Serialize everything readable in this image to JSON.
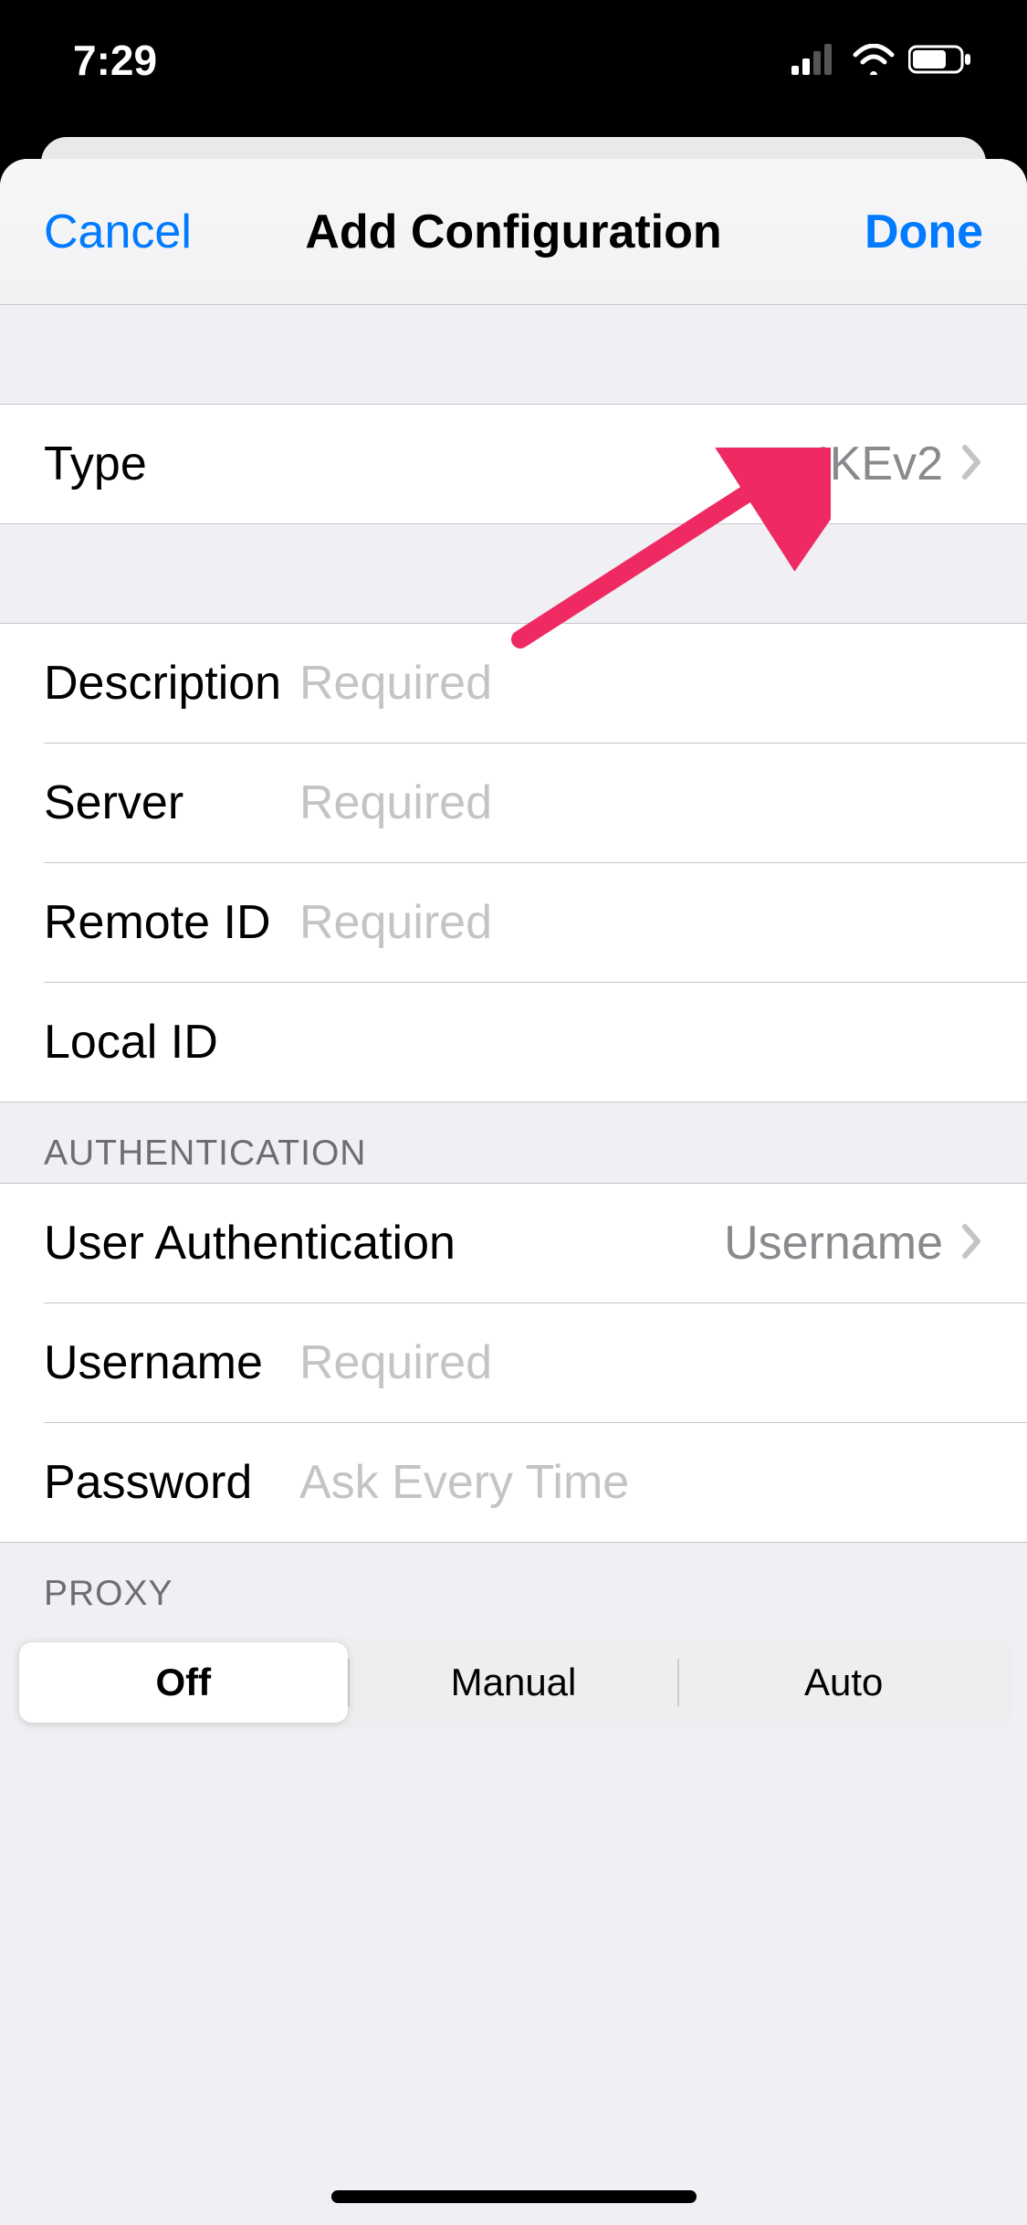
{
  "status_bar": {
    "time": "7:29"
  },
  "nav": {
    "cancel": "Cancel",
    "title": "Add Configuration",
    "done": "Done"
  },
  "type_row": {
    "label": "Type",
    "value": "IKEv2"
  },
  "connection": {
    "description_label": "Description",
    "description_placeholder": "Required",
    "server_label": "Server",
    "server_placeholder": "Required",
    "remote_id_label": "Remote ID",
    "remote_id_placeholder": "Required",
    "local_id_label": "Local ID"
  },
  "auth": {
    "header": "AUTHENTICATION",
    "user_auth_label": "User Authentication",
    "user_auth_value": "Username",
    "username_label": "Username",
    "username_placeholder": "Required",
    "password_label": "Password",
    "password_placeholder": "Ask Every Time"
  },
  "proxy": {
    "header": "PROXY",
    "options": [
      "Off",
      "Manual",
      "Auto"
    ],
    "selected": "Off"
  }
}
